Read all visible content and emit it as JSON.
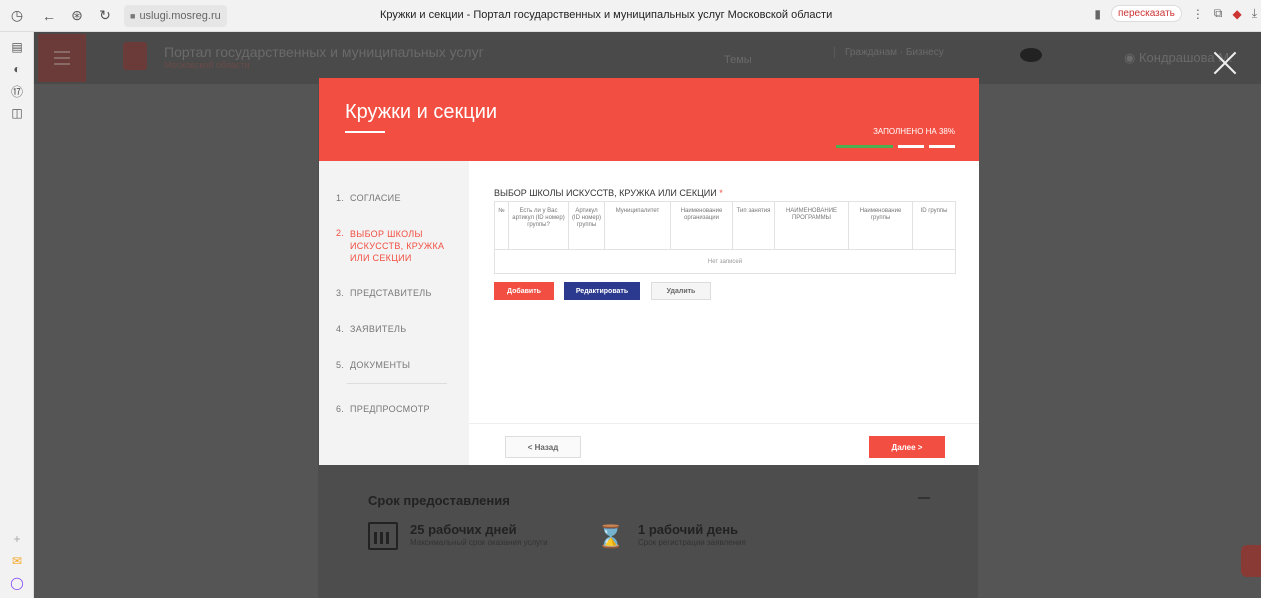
{
  "browser": {
    "address": "uslugi.mosreg.ru",
    "tab_title": "Кружки и секции - Портал государственных и муниципальных услуг Московской области",
    "retell_label": "пересказать",
    "icons": [
      "history-icon",
      "back-icon",
      "protect-icon",
      "reload-icon",
      "lock-icon",
      "bookmark-icon",
      "menu-dots-icon",
      "collections-icon",
      "extension-icon",
      "download-icon"
    ]
  },
  "site": {
    "portal_title": "Портал государственных и муниципальных услуг",
    "portal_subtitle": "Московской области",
    "themes": "Темы",
    "citizens": "Гражданам · Бизнесу",
    "user_name": "Кондрашова М.",
    "term_title": "Срок предоставления",
    "term1_value": "25 рабочих дней",
    "term1_sub": "Максимальный срок оказания услуги",
    "term2_value": "1 рабочий день",
    "term2_sub": "Срок регистрации заявления"
  },
  "modal": {
    "title": "Кружки и секции",
    "progress_text": "ЗАПОЛНЕНО НА 38%",
    "progress_fraction": 0.38,
    "accent": "#f24f42",
    "steps": [
      {
        "num": "1.",
        "label": "СОГЛАСИЕ"
      },
      {
        "num": "2.",
        "label": "ВЫБОР ШКОЛЫ ИСКУССТВ, КРУЖКА ИЛИ СЕКЦИИ"
      },
      {
        "num": "3.",
        "label": "ПРЕДСТАВИТЕЛЬ"
      },
      {
        "num": "4.",
        "label": "ЗАЯВИТЕЛЬ"
      },
      {
        "num": "5.",
        "label": "ДОКУМЕНТЫ"
      },
      {
        "num": "6.",
        "label": "ПРЕДПРОСМОТР"
      }
    ],
    "section_title": "ВЫБОР ШКОЛЫ ИСКУССТВ, КРУЖКА ИЛИ СЕКЦИИ",
    "required_mark": "*",
    "table": {
      "columns": [
        "№",
        "Есть ли у Вас артикул (ID номер) группы?",
        "Артикул (ID номер) группы",
        "Муниципалитет",
        "Наименование организации",
        "Тип занятия",
        "НАИМЕНОВАНИЕ ПРОГРАММЫ",
        "Наименование группы",
        "ID группы"
      ],
      "empty_text": "Нет записей"
    },
    "btn_add": "Добавить",
    "btn_edit": "Редактировать",
    "btn_delete": "Удалить",
    "btn_back": "< Назад",
    "btn_next": "Далее >"
  }
}
